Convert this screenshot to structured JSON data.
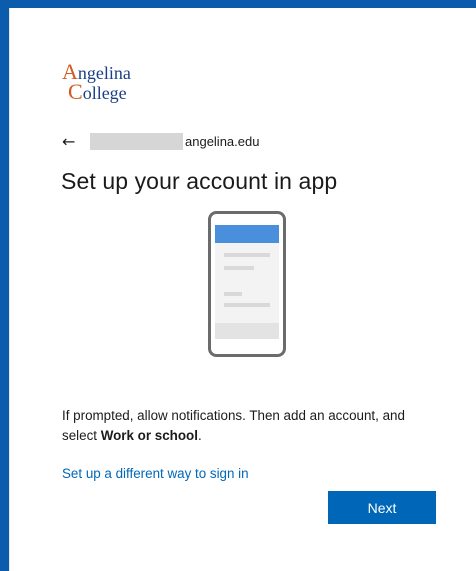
{
  "logo": {
    "line1_cap": "A",
    "line1_rest": "ngelina",
    "line2_cap": "C",
    "line2_rest": "ollege"
  },
  "identity": {
    "back_icon": "←",
    "domain": "angelina.edu"
  },
  "title": "Set up your account in app",
  "description": {
    "text": "If prompted, allow notifications. Then add an account, and select ",
    "bold": "Work or school",
    "end": "."
  },
  "alt_link": "Set up a different way to sign in",
  "next_button": "Next",
  "colors": {
    "frame": "#0b5cad",
    "accent": "#0067b8",
    "logo_blue": "#1b3f86",
    "logo_orange": "#d35a22"
  },
  "icons": {
    "back": "back-arrow-icon",
    "illustration": "phone-illustration-icon"
  }
}
